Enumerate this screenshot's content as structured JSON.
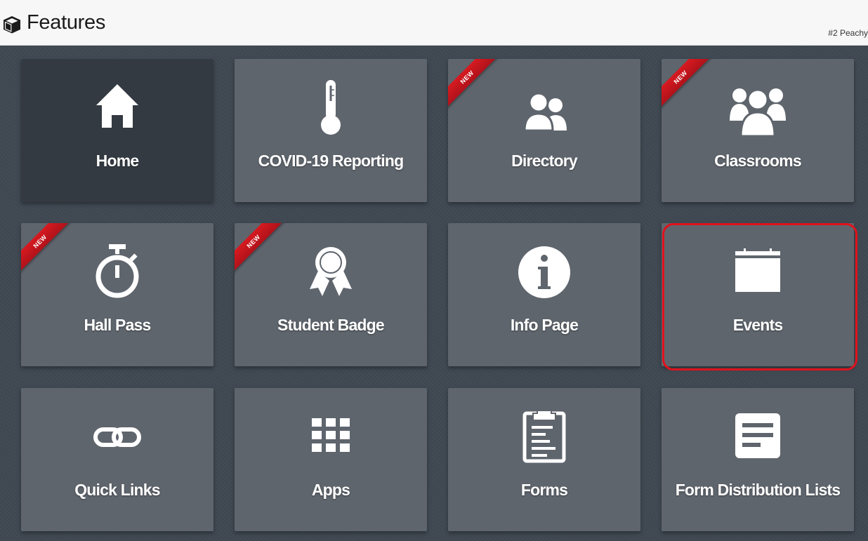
{
  "header": {
    "title": "Features",
    "title_icon": "cube-icon",
    "account": "#2 Peachy"
  },
  "ribbon_text": "NEW",
  "tiles": [
    {
      "label": "Home",
      "icon": "home-icon",
      "new": false,
      "selected": true
    },
    {
      "label": "COVID-19 Reporting",
      "icon": "thermometer-icon",
      "new": false
    },
    {
      "label": "Directory",
      "icon": "users-icon",
      "new": true
    },
    {
      "label": "Classrooms",
      "icon": "group-icon",
      "new": true
    },
    {
      "label": "Hall Pass",
      "icon": "stopwatch-icon",
      "new": true
    },
    {
      "label": "Student Badge",
      "icon": "badge-icon",
      "new": true
    },
    {
      "label": "Info Page",
      "icon": "info-icon",
      "new": false
    },
    {
      "label": "Events",
      "icon": "calendar-icon",
      "new": false,
      "highlighted": true
    },
    {
      "label": "Quick Links",
      "icon": "link-icon",
      "new": false
    },
    {
      "label": "Apps",
      "icon": "apps-grid-icon",
      "new": false
    },
    {
      "label": "Forms",
      "icon": "clipboard-icon",
      "new": false
    },
    {
      "label": "Form Distribution Lists",
      "icon": "list-document-icon",
      "new": false
    }
  ],
  "colors": {
    "background": "#3f4852",
    "tile": "#5f656d",
    "tile_selected": "#343a42",
    "ribbon": "#d71a20",
    "highlight": "#e0121c"
  }
}
